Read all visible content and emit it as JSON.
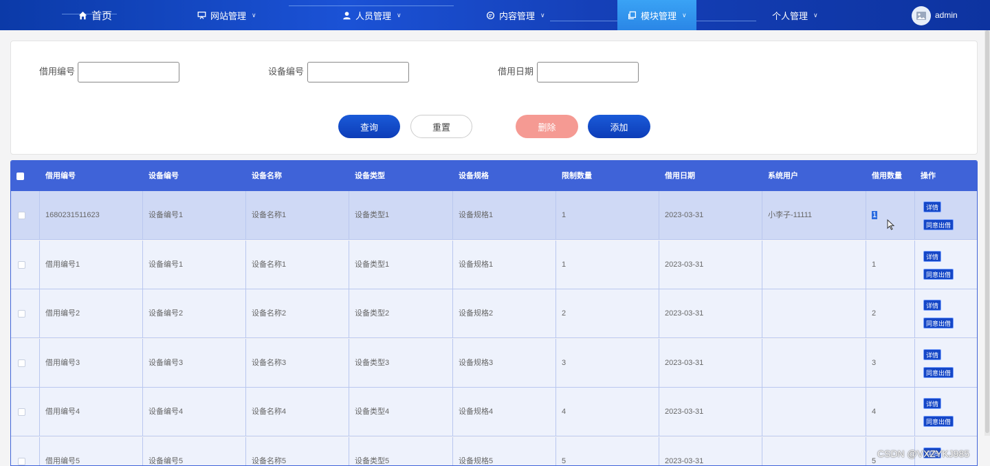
{
  "nav": {
    "home": "首页",
    "items": [
      "网站管理",
      "人员管理",
      "内容管理",
      "模块管理",
      "个人管理"
    ],
    "user": "admin"
  },
  "search": {
    "fields": [
      {
        "label": "借用编号",
        "value": ""
      },
      {
        "label": "设备编号",
        "value": ""
      },
      {
        "label": "借用日期",
        "value": ""
      }
    ],
    "buttons": {
      "query": "查询",
      "reset": "重置",
      "delete": "删除",
      "add": "添加"
    }
  },
  "table": {
    "headers": [
      "借用编号",
      "设备编号",
      "设备名称",
      "设备类型",
      "设备规格",
      "限制数量",
      "借用日期",
      "系统用户",
      "借用数量",
      "操作"
    ],
    "actions": {
      "detail": "详情",
      "approve": "同意出借"
    },
    "rows": [
      [
        "1680231511623",
        "设备编号1",
        "设备名称1",
        "设备类型1",
        "设备规格1",
        "1",
        "2023-03-31",
        "小李子-11111",
        "1"
      ],
      [
        "借用编号1",
        "设备编号1",
        "设备名称1",
        "设备类型1",
        "设备规格1",
        "1",
        "2023-03-31",
        "",
        "1"
      ],
      [
        "借用编号2",
        "设备编号2",
        "设备名称2",
        "设备类型2",
        "设备规格2",
        "2",
        "2023-03-31",
        "",
        "2"
      ],
      [
        "借用编号3",
        "设备编号3",
        "设备名称3",
        "设备类型3",
        "设备规格3",
        "3",
        "2023-03-31",
        "",
        "3"
      ],
      [
        "借用编号4",
        "设备编号4",
        "设备名称4",
        "设备类型4",
        "设备规格4",
        "4",
        "2023-03-31",
        "",
        "4"
      ],
      [
        "借用编号5",
        "设备编号5",
        "设备名称5",
        "设备类型5",
        "设备规格5",
        "5",
        "2023-03-31",
        "",
        "5"
      ]
    ]
  },
  "watermark": "CSDN @VXZYKJ985",
  "colors": {
    "nav": "#1b52d6",
    "header": "#3f63d8",
    "primary": "#1547c7",
    "danger": "#f59a93"
  }
}
